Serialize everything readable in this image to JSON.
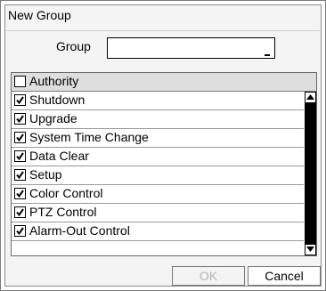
{
  "dialog": {
    "title": "New Group",
    "group_label": "Group",
    "group_value": "",
    "list_header": {
      "label": "Authority",
      "checked": false
    },
    "items": [
      {
        "label": "Shutdown",
        "checked": true
      },
      {
        "label": "Upgrade",
        "checked": true
      },
      {
        "label": "System Time Change",
        "checked": true
      },
      {
        "label": "Data Clear",
        "checked": true
      },
      {
        "label": "Setup",
        "checked": true
      },
      {
        "label": "Color Control",
        "checked": true
      },
      {
        "label": "PTZ Control",
        "checked": true
      },
      {
        "label": "Alarm-Out Control",
        "checked": true
      }
    ],
    "ok_label": "OK",
    "cancel_label": "Cancel"
  }
}
